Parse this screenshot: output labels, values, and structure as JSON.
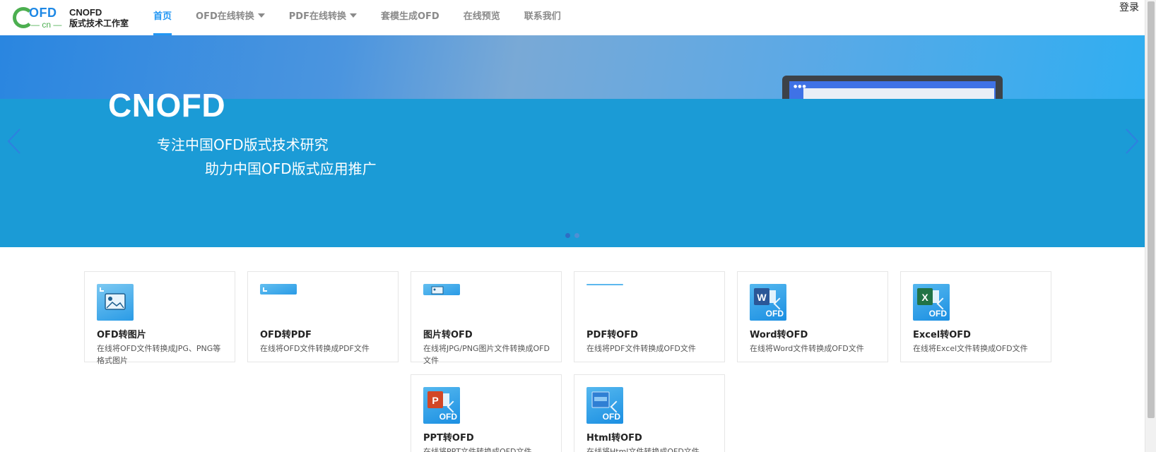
{
  "header": {
    "logo": {
      "ofd": "OFD",
      "cn": "— cn —"
    },
    "brand_name": "CNOFD",
    "brand_sub": "版式技术工作室",
    "nav": [
      {
        "label": "首页",
        "active": true,
        "dropdown": false
      },
      {
        "label": "OFD在线转换",
        "active": false,
        "dropdown": true
      },
      {
        "label": "PDF在线转换",
        "active": false,
        "dropdown": true
      },
      {
        "label": "套模生成OFD",
        "active": false,
        "dropdown": false
      },
      {
        "label": "在线预览",
        "active": false,
        "dropdown": false
      },
      {
        "label": "联系我们",
        "active": false,
        "dropdown": false
      }
    ],
    "login": "登录"
  },
  "banner": {
    "title": "CNOFD",
    "slogan1": "专注中国OFD版式技术研究",
    "slogan2": "助力中国OFD版式应用推广",
    "slides": 2,
    "active_slide": 0
  },
  "cards": [
    {
      "title": "OFD转图片",
      "desc": "在线将OFD文件转换成JPG、PNG等格式图片",
      "icon": "image-icon"
    },
    {
      "title": "OFD转PDF",
      "desc": "在线将OFD文件转换成PDF文件",
      "icon": "pdf-icon"
    },
    {
      "title": "图片转OFD",
      "desc": "在线将JPG/PNG图片文件转换成OFD文件",
      "icon": "image-icon"
    },
    {
      "title": "PDF转OFD",
      "desc": "在线将PDF文件转换成OFD文件",
      "icon": "pdf-icon"
    },
    {
      "title": "Word转OFD",
      "desc": "在线将Word文件转换成OFD文件",
      "icon": "word-icon"
    },
    {
      "title": "Excel转OFD",
      "desc": "在线将Excel文件转换成OFD文件",
      "icon": "excel-icon"
    },
    {
      "title": "PPT转OFD",
      "desc": "在线将PPT文件转换成OFD文件",
      "icon": "ppt-icon"
    },
    {
      "title": "Html转OFD",
      "desc": "在线将Html文件转换成OFD文件",
      "icon": "html-icon"
    }
  ],
  "icon_ofd_label": "OFD",
  "colors": {
    "accent": "#2196f3",
    "banner": "#1b9bd6",
    "word": "#2b5797",
    "excel": "#217346",
    "ppt": "#d24726"
  }
}
